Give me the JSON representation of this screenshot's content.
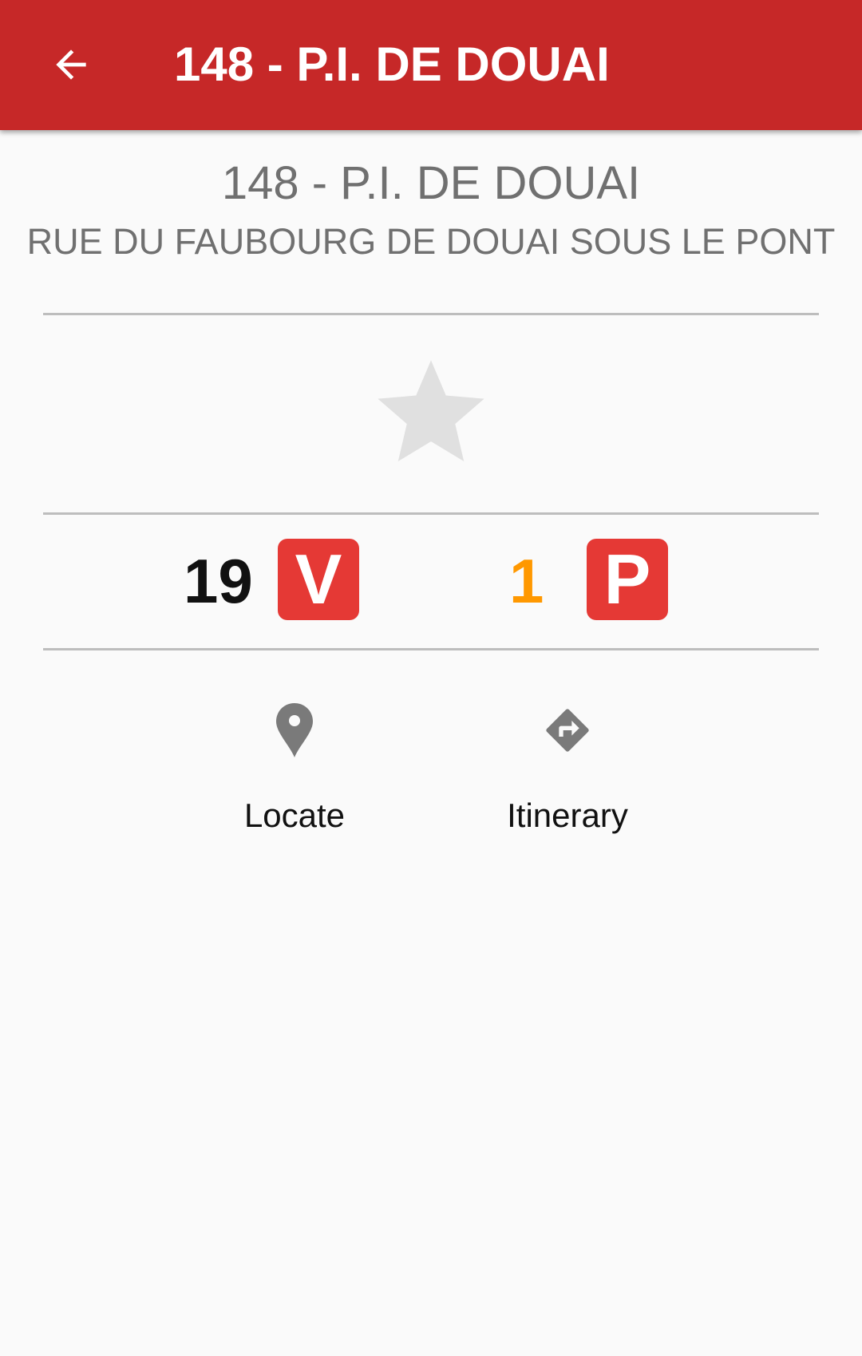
{
  "appbar": {
    "title": "148 - P.I. DE DOUAI",
    "back_icon": "arrow-back-icon",
    "background_color": "#c62828"
  },
  "station": {
    "name": "148 - P.I. DE DOUAI",
    "address": "RUE DU FAUBOURG DE DOUAI SOUS LE PONT"
  },
  "favorite": {
    "icon": "star-icon",
    "is_favorite": false,
    "color": "#e0e0e0"
  },
  "availability": {
    "bikes": {
      "count": "19",
      "badge_letter": "V",
      "count_color": "#111111"
    },
    "places": {
      "count": "1",
      "badge_letter": "P",
      "count_color": "#ff9800"
    },
    "badge_color": "#e53935"
  },
  "actions": [
    {
      "label": "Locate",
      "icon": "map-pin-icon"
    },
    {
      "label": "Itinerary",
      "icon": "directions-icon"
    }
  ]
}
